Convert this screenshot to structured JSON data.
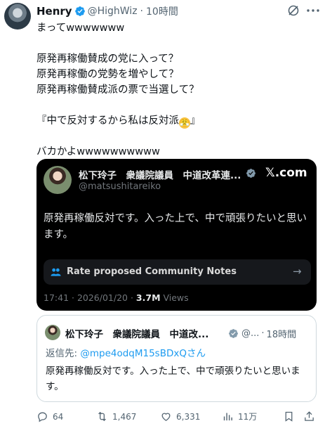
{
  "tweet": {
    "author_name": "Henry",
    "author_handle": "@HighWiz",
    "separator": "·",
    "time": "10時間",
    "lines": [
      "まってwwwwwww",
      "原発再稼働賛成の党に入って？\n原発再稼働の党勢を増やして？\n原発再稼働賛成派の票で当選して？",
      "『中で反対するから私は反対派",
      "バカかよwwwwwwwwww"
    ],
    "emoji": "😤",
    "line3_end": "』"
  },
  "embed": {
    "author_name": "松下玲子　衆議院議員　中道改革連...",
    "author_handle": "@matsushitareiko",
    "platform_label": "𝕏.com",
    "text": "原発再稼働反対です。入った上で、中で頑張りたいと思います。",
    "community_notes_label": "Rate proposed Community Notes",
    "arrow": "→",
    "timestamp": "17:41 · 2026/01/20 · ",
    "views_count": "3.7M",
    "views_label": " Views"
  },
  "quote": {
    "author_name": "松下玲子　衆議院議員　中道改...",
    "author_handle": "@...",
    "separator": "·",
    "time": "18時間",
    "reply_prefix": "返信先: ",
    "reply_to": "@mpe4odqM15sBDxQさん",
    "text": "原発再稼働反対です。入った上で、中で頑張りたいと思います。"
  },
  "actions": {
    "replies": "64",
    "reposts": "1,467",
    "likes": "6,331",
    "views": "11万"
  },
  "colors": {
    "verified_blue": "#1d9bf0",
    "verified_gray": "#829aab",
    "text_primary": "#0f1419",
    "text_secondary": "#536471",
    "embed_bg": "#000000"
  },
  "icons": [
    "verified-badge-icon",
    "grok-icon",
    "more-icon",
    "community-notes-icon",
    "reply-icon",
    "repost-icon",
    "like-icon",
    "views-icon",
    "bookmark-icon",
    "share-icon"
  ]
}
